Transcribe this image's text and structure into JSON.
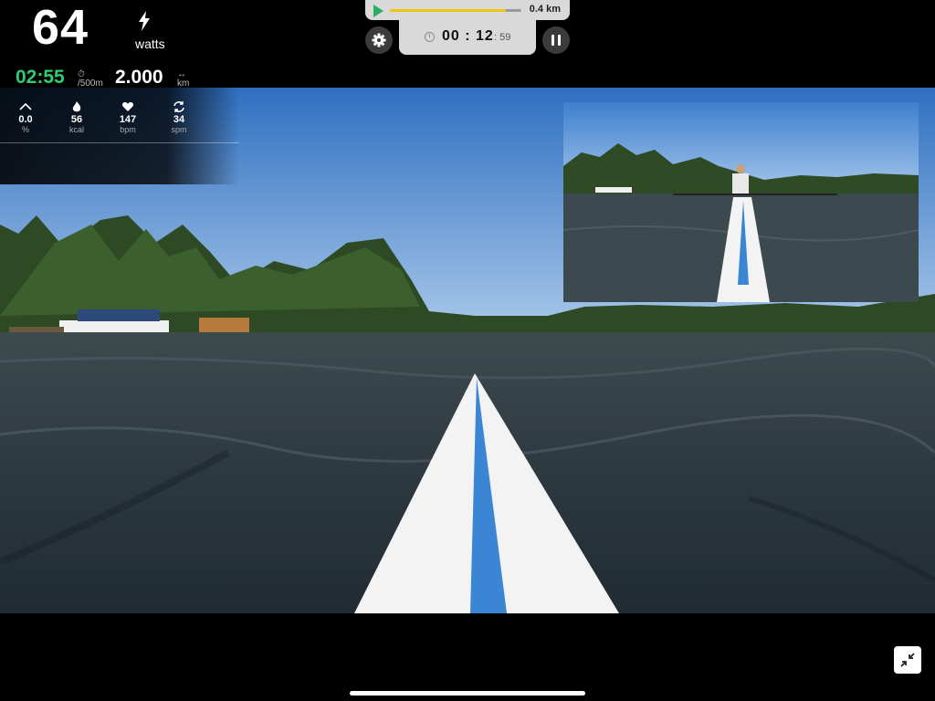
{
  "metrics": {
    "watts_value": "64",
    "watts_label": "watts",
    "pace_value": "02:55",
    "pace_unit": "/500m",
    "distance_value": "2.000",
    "distance_unit": "km"
  },
  "stats": [
    {
      "icon": "incline-icon",
      "value": "0.0",
      "unit": "%"
    },
    {
      "icon": "flame-icon",
      "value": "56",
      "unit": "kcal"
    },
    {
      "icon": "heart-icon",
      "value": "147",
      "unit": "bpm"
    },
    {
      "icon": "stroke-rate-icon",
      "value": "34",
      "unit": "spm"
    }
  ],
  "progress": {
    "distance_label": "0.4 km",
    "fraction": 0.88
  },
  "timer": {
    "main": "00 : 12",
    "seconds": ": 59"
  },
  "colors": {
    "pace_green": "#2ecc71",
    "progress_yellow": "#f1c40f",
    "play_green": "#27ae60",
    "boat_stripe": "#3a86d4"
  }
}
